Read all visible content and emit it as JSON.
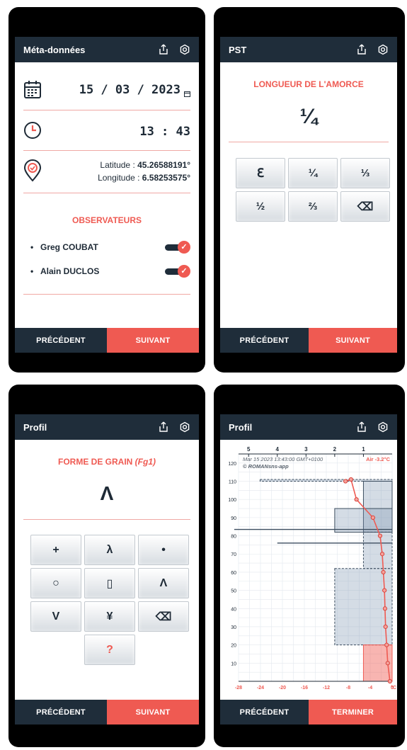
{
  "screen1": {
    "title": "Méta-données",
    "date": "15 / 03 / 2023",
    "time": "13 : 43",
    "latitude_label": "Latitude : ",
    "latitude_value": "45.26588191°",
    "longitude_label": "Longitude : ",
    "longitude_value": "6.58253575°",
    "observers_title": "OBSERVATEURS",
    "observers": [
      {
        "name": "Greg COUBAT",
        "enabled": true
      },
      {
        "name": "Alain DUCLOS",
        "enabled": true
      }
    ],
    "prev_label": "PRÉCÉDENT",
    "next_label": "SUIVANT"
  },
  "screen2": {
    "title": "PST",
    "section_title": "LONGUEUR DE L'AMORCE",
    "value": "¼",
    "keys": [
      "ℇ",
      "¼",
      "⅓",
      "½",
      "⅔",
      "⌫"
    ],
    "prev_label": "PRÉCÉDENT",
    "next_label": "SUIVANT"
  },
  "screen3": {
    "title": "Profil",
    "section_title_main": "FORME DE GRAIN ",
    "section_title_code": "(Fg1)",
    "value": "Λ",
    "keys": [
      "+",
      "λ",
      "•",
      "○",
      "▯",
      "Λ",
      "V",
      "¥",
      "⌫",
      "?"
    ],
    "prev_label": "PRÉCÉDENT",
    "next_label": "SUIVANT"
  },
  "screen4": {
    "title": "Profil",
    "prev_label": "PRÉCÉDENT",
    "next_label": "TERMINER"
  },
  "colors": {
    "header": "#1f2d3a",
    "accent": "#ef5a52",
    "separator": "#f0a8a4"
  },
  "chart_data": {
    "type": "line",
    "annotation_date": "Mar 15 2023 13:43:00 GMT+0100",
    "annotation_credit": "© ROMANsns-app",
    "annotation_air": "Air -3.2°C",
    "top_axis_ticks": [
      "5",
      "4",
      "3",
      "2",
      "1"
    ],
    "bottom_axis_ticks": [
      "-28",
      "-24",
      "-20",
      "-16",
      "-12",
      "-8",
      "-4",
      "0"
    ],
    "bottom_axis_unit": "°C",
    "y_ticks": [
      "120",
      "110",
      "100",
      "90",
      "80",
      "70",
      "60",
      "50",
      "40",
      "30",
      "20",
      "10"
    ],
    "ylim": [
      0,
      125
    ],
    "temperature_points": [
      {
        "t": -8.5,
        "h": 110
      },
      {
        "t": -7.5,
        "h": 111
      },
      {
        "t": -6.5,
        "h": 100
      },
      {
        "t": -3.5,
        "h": 90
      },
      {
        "t": -2.2,
        "h": 80
      },
      {
        "t": -1.8,
        "h": 70
      },
      {
        "t": -1.6,
        "h": 60
      },
      {
        "t": -1.4,
        "h": 50
      },
      {
        "t": -1.3,
        "h": 40
      },
      {
        "t": -1.2,
        "h": 30
      },
      {
        "t": -1.0,
        "h": 20
      },
      {
        "t": -0.8,
        "h": 10
      },
      {
        "t": -0.4,
        "h": 0
      }
    ],
    "hardness_layers": [
      {
        "top": 111,
        "bottom": 110,
        "hardness_index": 4.6,
        "style": "dashed"
      },
      {
        "top": 110,
        "bottom": 82,
        "hardness_index": 1.0,
        "style": "solid"
      },
      {
        "top": 95,
        "bottom": 82,
        "hardness_index": 2.0,
        "style": "solid"
      },
      {
        "top": 82,
        "bottom": 62,
        "hardness_index": 1.0,
        "style": "dashed"
      },
      {
        "top": 62,
        "bottom": 20,
        "hardness_index": 2.0,
        "style": "dashed"
      },
      {
        "top": 20,
        "bottom": 0,
        "hardness_index": 1.0,
        "style": "red"
      }
    ],
    "horizontal_lines": [
      {
        "h": 83.5,
        "from_hardness_index": 5.5
      },
      {
        "h": 76,
        "from_hardness_index": 4.0
      }
    ]
  }
}
